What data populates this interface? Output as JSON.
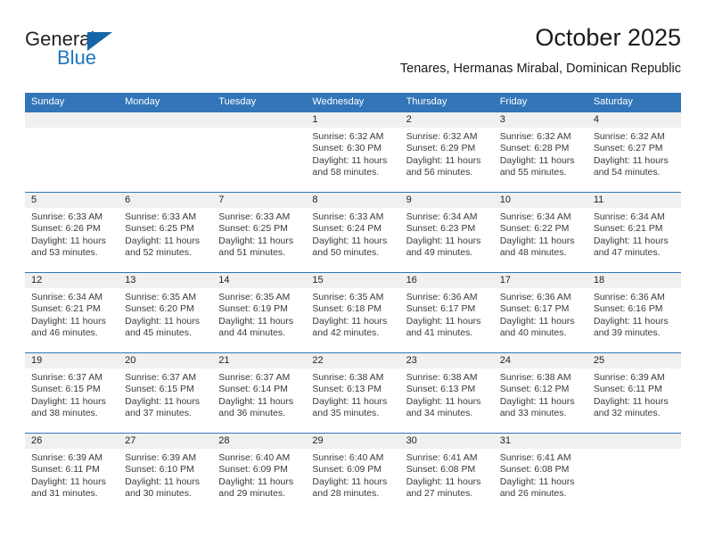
{
  "logo": {
    "word_one": "General",
    "word_two": "Blue",
    "triangle_color": "#1565a8"
  },
  "header": {
    "title": "October 2025",
    "subtitle": "Tenares, Hermanas Mirabal, Dominican Republic"
  },
  "theme": {
    "header_blue": "#3275b9",
    "day_band_gray": "#f0f0f0",
    "text_color": "#3a3a3a"
  },
  "weekdays": [
    "Sunday",
    "Monday",
    "Tuesday",
    "Wednesday",
    "Thursday",
    "Friday",
    "Saturday"
  ],
  "weeks": [
    [
      {
        "day": "",
        "sunrise": "",
        "sunset": "",
        "daylight_1": "",
        "daylight_2": ""
      },
      {
        "day": "",
        "sunrise": "",
        "sunset": "",
        "daylight_1": "",
        "daylight_2": ""
      },
      {
        "day": "",
        "sunrise": "",
        "sunset": "",
        "daylight_1": "",
        "daylight_2": ""
      },
      {
        "day": "1",
        "sunrise": "Sunrise: 6:32 AM",
        "sunset": "Sunset: 6:30 PM",
        "daylight_1": "Daylight: 11 hours",
        "daylight_2": "and 58 minutes."
      },
      {
        "day": "2",
        "sunrise": "Sunrise: 6:32 AM",
        "sunset": "Sunset: 6:29 PM",
        "daylight_1": "Daylight: 11 hours",
        "daylight_2": "and 56 minutes."
      },
      {
        "day": "3",
        "sunrise": "Sunrise: 6:32 AM",
        "sunset": "Sunset: 6:28 PM",
        "daylight_1": "Daylight: 11 hours",
        "daylight_2": "and 55 minutes."
      },
      {
        "day": "4",
        "sunrise": "Sunrise: 6:32 AM",
        "sunset": "Sunset: 6:27 PM",
        "daylight_1": "Daylight: 11 hours",
        "daylight_2": "and 54 minutes."
      }
    ],
    [
      {
        "day": "5",
        "sunrise": "Sunrise: 6:33 AM",
        "sunset": "Sunset: 6:26 PM",
        "daylight_1": "Daylight: 11 hours",
        "daylight_2": "and 53 minutes."
      },
      {
        "day": "6",
        "sunrise": "Sunrise: 6:33 AM",
        "sunset": "Sunset: 6:25 PM",
        "daylight_1": "Daylight: 11 hours",
        "daylight_2": "and 52 minutes."
      },
      {
        "day": "7",
        "sunrise": "Sunrise: 6:33 AM",
        "sunset": "Sunset: 6:25 PM",
        "daylight_1": "Daylight: 11 hours",
        "daylight_2": "and 51 minutes."
      },
      {
        "day": "8",
        "sunrise": "Sunrise: 6:33 AM",
        "sunset": "Sunset: 6:24 PM",
        "daylight_1": "Daylight: 11 hours",
        "daylight_2": "and 50 minutes."
      },
      {
        "day": "9",
        "sunrise": "Sunrise: 6:34 AM",
        "sunset": "Sunset: 6:23 PM",
        "daylight_1": "Daylight: 11 hours",
        "daylight_2": "and 49 minutes."
      },
      {
        "day": "10",
        "sunrise": "Sunrise: 6:34 AM",
        "sunset": "Sunset: 6:22 PM",
        "daylight_1": "Daylight: 11 hours",
        "daylight_2": "and 48 minutes."
      },
      {
        "day": "11",
        "sunrise": "Sunrise: 6:34 AM",
        "sunset": "Sunset: 6:21 PM",
        "daylight_1": "Daylight: 11 hours",
        "daylight_2": "and 47 minutes."
      }
    ],
    [
      {
        "day": "12",
        "sunrise": "Sunrise: 6:34 AM",
        "sunset": "Sunset: 6:21 PM",
        "daylight_1": "Daylight: 11 hours",
        "daylight_2": "and 46 minutes."
      },
      {
        "day": "13",
        "sunrise": "Sunrise: 6:35 AM",
        "sunset": "Sunset: 6:20 PM",
        "daylight_1": "Daylight: 11 hours",
        "daylight_2": "and 45 minutes."
      },
      {
        "day": "14",
        "sunrise": "Sunrise: 6:35 AM",
        "sunset": "Sunset: 6:19 PM",
        "daylight_1": "Daylight: 11 hours",
        "daylight_2": "and 44 minutes."
      },
      {
        "day": "15",
        "sunrise": "Sunrise: 6:35 AM",
        "sunset": "Sunset: 6:18 PM",
        "daylight_1": "Daylight: 11 hours",
        "daylight_2": "and 42 minutes."
      },
      {
        "day": "16",
        "sunrise": "Sunrise: 6:36 AM",
        "sunset": "Sunset: 6:17 PM",
        "daylight_1": "Daylight: 11 hours",
        "daylight_2": "and 41 minutes."
      },
      {
        "day": "17",
        "sunrise": "Sunrise: 6:36 AM",
        "sunset": "Sunset: 6:17 PM",
        "daylight_1": "Daylight: 11 hours",
        "daylight_2": "and 40 minutes."
      },
      {
        "day": "18",
        "sunrise": "Sunrise: 6:36 AM",
        "sunset": "Sunset: 6:16 PM",
        "daylight_1": "Daylight: 11 hours",
        "daylight_2": "and 39 minutes."
      }
    ],
    [
      {
        "day": "19",
        "sunrise": "Sunrise: 6:37 AM",
        "sunset": "Sunset: 6:15 PM",
        "daylight_1": "Daylight: 11 hours",
        "daylight_2": "and 38 minutes."
      },
      {
        "day": "20",
        "sunrise": "Sunrise: 6:37 AM",
        "sunset": "Sunset: 6:15 PM",
        "daylight_1": "Daylight: 11 hours",
        "daylight_2": "and 37 minutes."
      },
      {
        "day": "21",
        "sunrise": "Sunrise: 6:37 AM",
        "sunset": "Sunset: 6:14 PM",
        "daylight_1": "Daylight: 11 hours",
        "daylight_2": "and 36 minutes."
      },
      {
        "day": "22",
        "sunrise": "Sunrise: 6:38 AM",
        "sunset": "Sunset: 6:13 PM",
        "daylight_1": "Daylight: 11 hours",
        "daylight_2": "and 35 minutes."
      },
      {
        "day": "23",
        "sunrise": "Sunrise: 6:38 AM",
        "sunset": "Sunset: 6:13 PM",
        "daylight_1": "Daylight: 11 hours",
        "daylight_2": "and 34 minutes."
      },
      {
        "day": "24",
        "sunrise": "Sunrise: 6:38 AM",
        "sunset": "Sunset: 6:12 PM",
        "daylight_1": "Daylight: 11 hours",
        "daylight_2": "and 33 minutes."
      },
      {
        "day": "25",
        "sunrise": "Sunrise: 6:39 AM",
        "sunset": "Sunset: 6:11 PM",
        "daylight_1": "Daylight: 11 hours",
        "daylight_2": "and 32 minutes."
      }
    ],
    [
      {
        "day": "26",
        "sunrise": "Sunrise: 6:39 AM",
        "sunset": "Sunset: 6:11 PM",
        "daylight_1": "Daylight: 11 hours",
        "daylight_2": "and 31 minutes."
      },
      {
        "day": "27",
        "sunrise": "Sunrise: 6:39 AM",
        "sunset": "Sunset: 6:10 PM",
        "daylight_1": "Daylight: 11 hours",
        "daylight_2": "and 30 minutes."
      },
      {
        "day": "28",
        "sunrise": "Sunrise: 6:40 AM",
        "sunset": "Sunset: 6:09 PM",
        "daylight_1": "Daylight: 11 hours",
        "daylight_2": "and 29 minutes."
      },
      {
        "day": "29",
        "sunrise": "Sunrise: 6:40 AM",
        "sunset": "Sunset: 6:09 PM",
        "daylight_1": "Daylight: 11 hours",
        "daylight_2": "and 28 minutes."
      },
      {
        "day": "30",
        "sunrise": "Sunrise: 6:41 AM",
        "sunset": "Sunset: 6:08 PM",
        "daylight_1": "Daylight: 11 hours",
        "daylight_2": "and 27 minutes."
      },
      {
        "day": "31",
        "sunrise": "Sunrise: 6:41 AM",
        "sunset": "Sunset: 6:08 PM",
        "daylight_1": "Daylight: 11 hours",
        "daylight_2": "and 26 minutes."
      },
      {
        "day": "",
        "sunrise": "",
        "sunset": "",
        "daylight_1": "",
        "daylight_2": ""
      }
    ]
  ]
}
